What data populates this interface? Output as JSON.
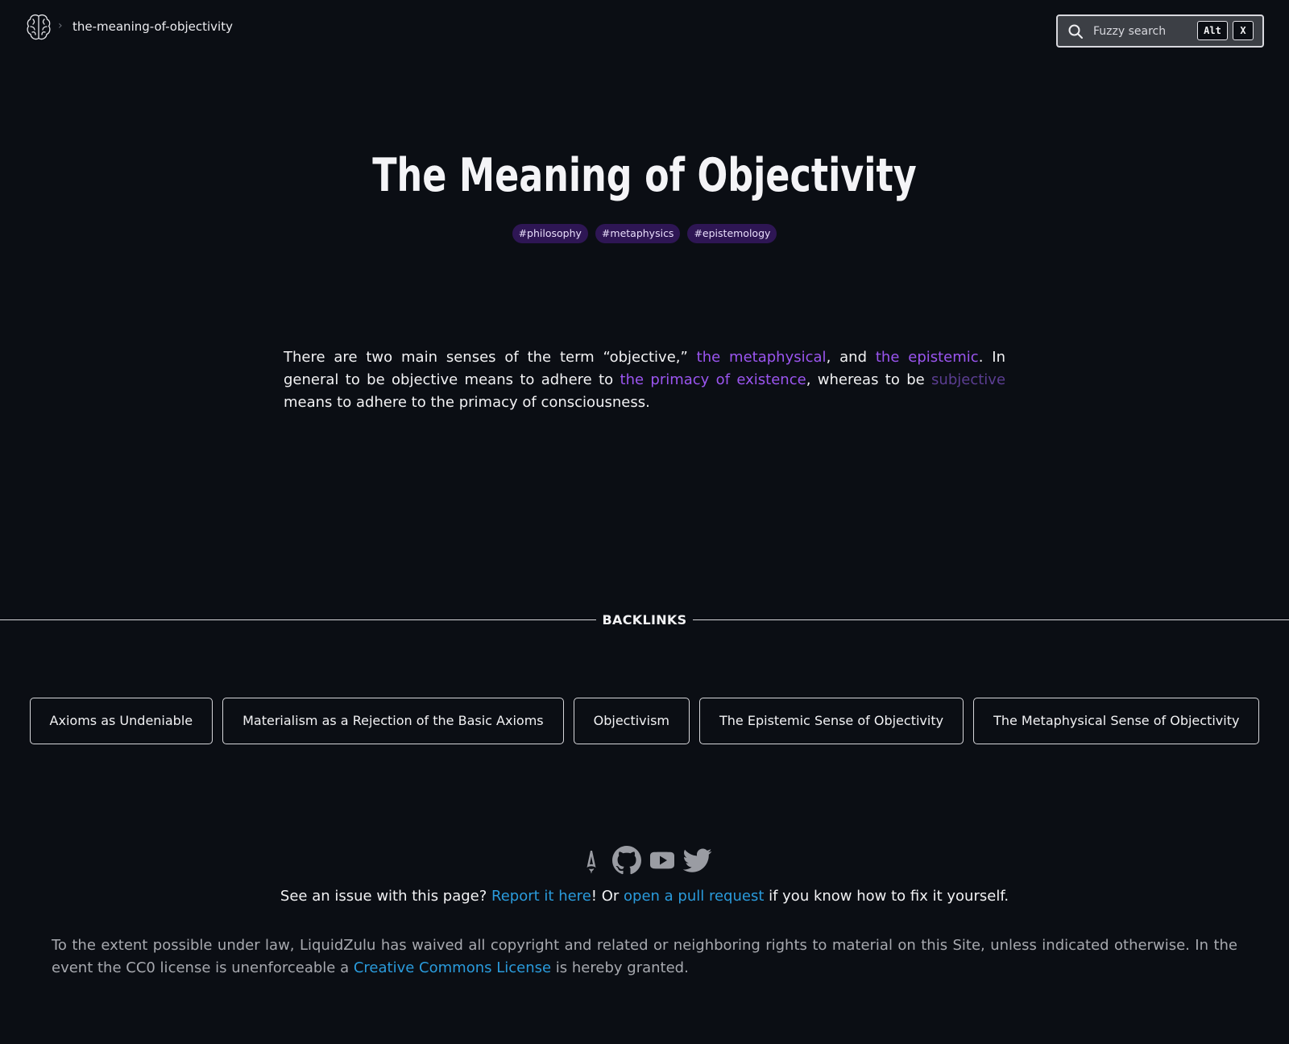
{
  "header": {
    "breadcrumb_current": "the-meaning-of-objectivity",
    "breadcrumb_separator": "›",
    "logo_icon": "brain-icon",
    "search": {
      "placeholder": "Fuzzy search",
      "shortcut_keys": [
        "Alt",
        "X"
      ],
      "icon": "search-icon"
    }
  },
  "article": {
    "title": "The Meaning of Objectivity",
    "tags": [
      "#philosophy",
      "#metaphysics",
      "#epistemology"
    ],
    "paragraph": {
      "t1": "There are two main senses of the term “objective,” ",
      "link_metaphysical": "the metaphysical",
      "t2": ", and ",
      "link_epistemic": "the epistemic",
      "t3": ". In general to be objective means to adhere to ",
      "link_primacy": "the primacy of existence",
      "t4": ", whereas to be ",
      "link_subjective": "subjective",
      "t5": " means to adhere to the primacy of consciousness."
    }
  },
  "backlinks": {
    "heading": "BACKLINKS",
    "items": [
      "Axioms as Undeniable",
      "Materialism as a Rejection of the Basic Axioms",
      "Objectivism",
      "The Epistemic Sense of Objectivity",
      "The Metaphysical Sense of Objectivity"
    ]
  },
  "footer": {
    "social_icons": [
      "astro-icon",
      "github-icon",
      "youtube-icon",
      "twitter-icon"
    ],
    "report": {
      "t1": "See an issue with this page? ",
      "link_report": "Report it here",
      "t2": "! Or ",
      "link_pr": "open a pull request",
      "t3": " if you know how to fix it yourself."
    },
    "license": {
      "t1": "To the extent possible under law, LiquidZulu has waived all copyright and related or neighboring rights to material on this Site, unless indicated otherwise. In the event the CC0 license is unenforceable a ",
      "link_cc": "Creative Commons License",
      "t2": " is hereby granted."
    }
  },
  "colors": {
    "background": "#0b0e14",
    "accent_link": "#9b55f0",
    "tag_background": "#2e1654",
    "footer_link": "#2a9bdc"
  }
}
